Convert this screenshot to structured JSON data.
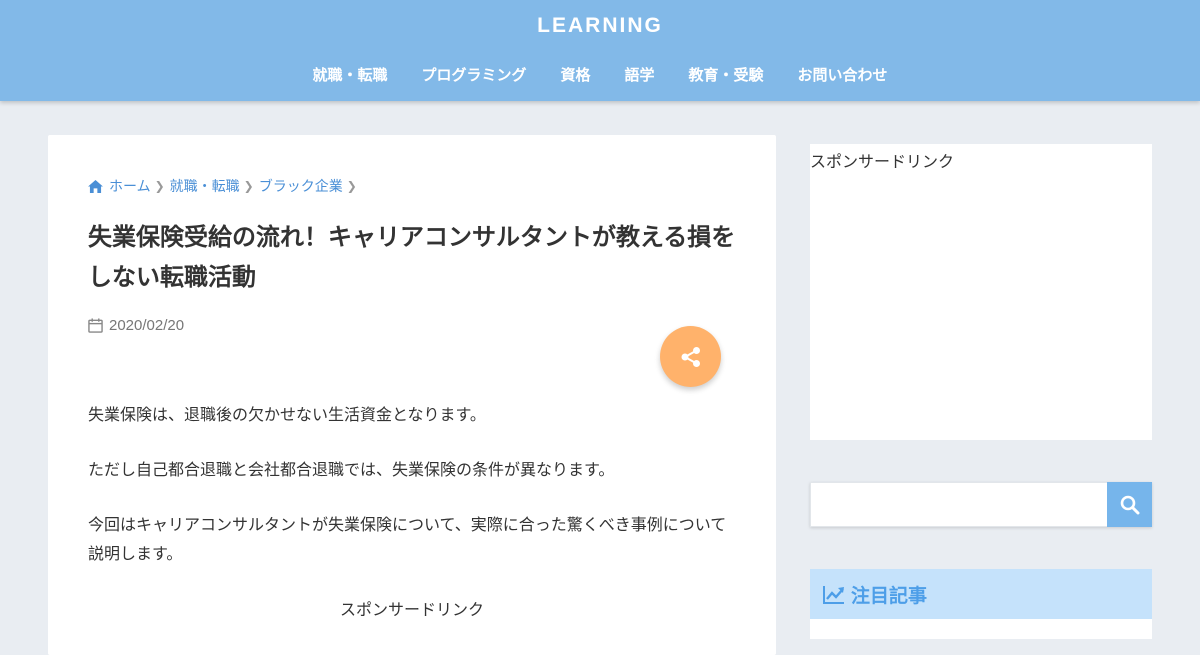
{
  "header": {
    "site_title": "LEARNING",
    "nav": [
      "就職・転職",
      "プログラミング",
      "資格",
      "語学",
      "教育・受験",
      "お問い合わせ"
    ]
  },
  "breadcrumb": {
    "home": "ホーム",
    "category": "就職・転職",
    "subcategory": "ブラック企業"
  },
  "article": {
    "title": "失業保険受給の流れ！キャリアコンサルタントが教える損をしない転職活動",
    "date": "2020/02/20",
    "paragraphs": [
      "失業保険は、退職後の欠かせない生活資金となります。",
      "ただし自己都合退職と会社都合退職では、失業保険の条件が異なります。",
      "今回はキャリアコンサルタントが失業保険について、実際に合った驚くべき事例について説明します。"
    ],
    "sponsor_label": "スポンサードリンク"
  },
  "sidebar": {
    "ad_label": "スポンサードリンク",
    "search": {
      "placeholder": "",
      "value": ""
    },
    "widget_title": "注目記事"
  },
  "colors": {
    "header_bg": "#82b9e8",
    "link": "#4a8fd6",
    "share_button": "#ffb26b",
    "search_button": "#76b5eb",
    "widget_title_bg": "#c5e2fb",
    "widget_title_text": "#4d9ee8"
  },
  "icons": {
    "home": "home-icon",
    "separator": "chevron-right-icon",
    "date": "calendar-icon",
    "share": "share-icon",
    "search": "search-icon",
    "widget": "trending-up-icon"
  }
}
